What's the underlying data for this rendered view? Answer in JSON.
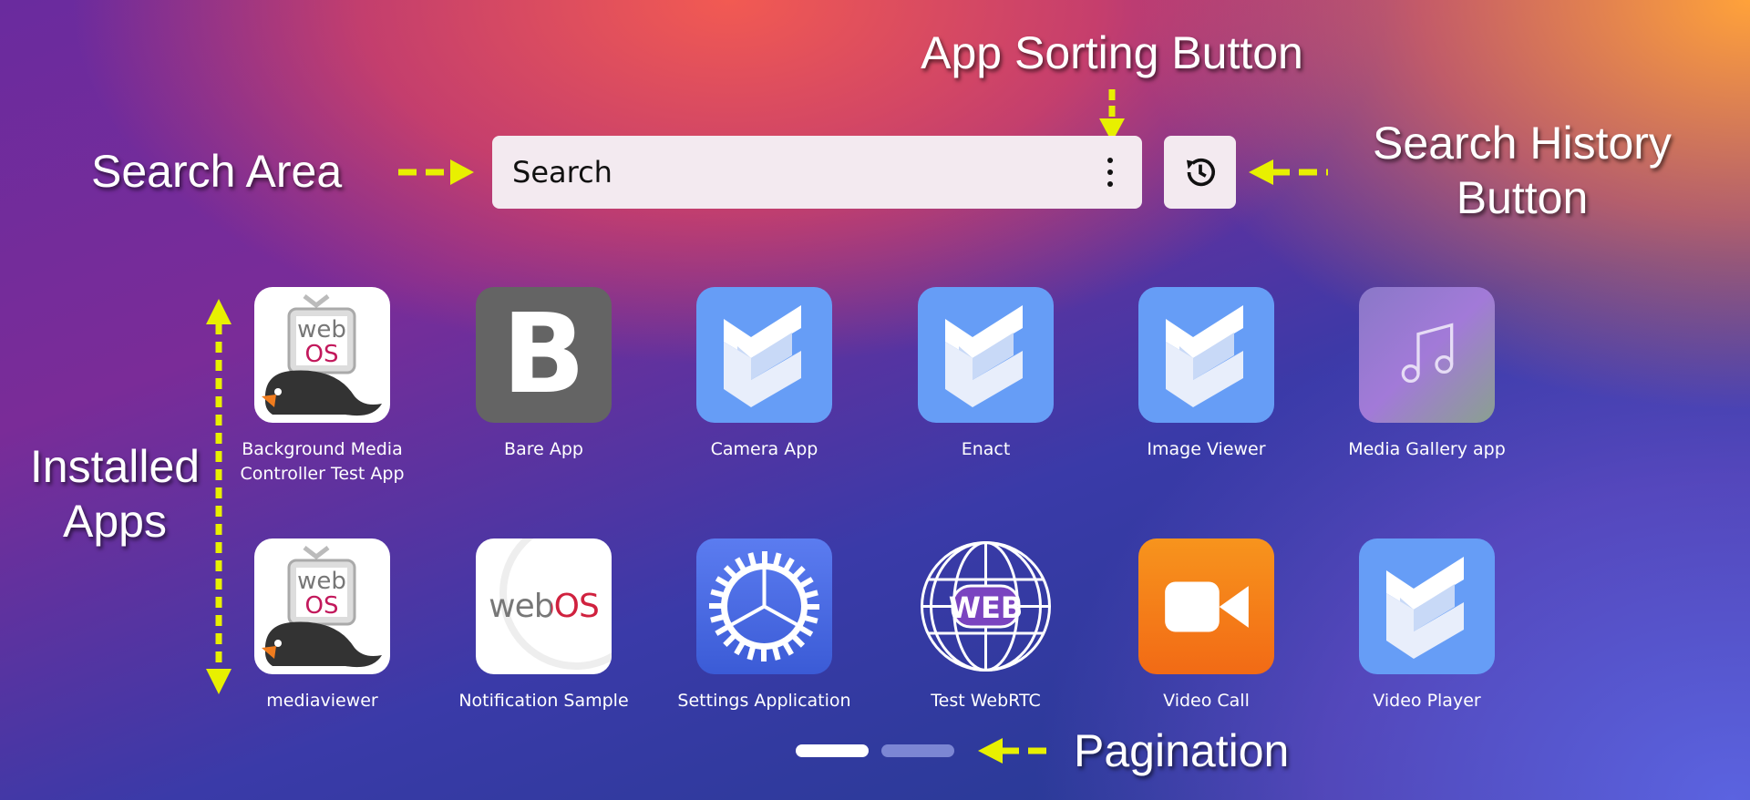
{
  "annotations": {
    "sorting": "App Sorting Button",
    "search_area": "Search Area",
    "history_line1": "Search History",
    "history_line2": "Button",
    "installed_line1": "Installed",
    "installed_line2": "Apps",
    "pagination": "Pagination",
    "arrow_color": "#e8f000"
  },
  "search": {
    "placeholder": "Search",
    "sort_icon": "more-vertical-icon",
    "history_icon": "history-icon"
  },
  "apps": [
    {
      "label": "Background Media Controller Test App",
      "icon": "webos-penguin"
    },
    {
      "label": "Bare App",
      "icon": "letter-b"
    },
    {
      "label": "Camera App",
      "icon": "enact"
    },
    {
      "label": "Enact",
      "icon": "enact"
    },
    {
      "label": "Image Viewer",
      "icon": "enact"
    },
    {
      "label": "Media Gallery app",
      "icon": "music-note"
    },
    {
      "label": "mediaviewer",
      "icon": "webos-penguin"
    },
    {
      "label": "Notification Sample",
      "icon": "webos-logo"
    },
    {
      "label": "Settings Application",
      "icon": "gear"
    },
    {
      "label": "Test WebRTC",
      "icon": "web-globe"
    },
    {
      "label": "Video Call",
      "icon": "video-camera"
    },
    {
      "label": "Video Player",
      "icon": "enact"
    }
  ],
  "icon_text": {
    "web": "web",
    "os": "OS",
    "webos": "webOS",
    "b": "B",
    "globe": "WEB"
  },
  "pagination": {
    "pages": 2,
    "current": 1
  }
}
